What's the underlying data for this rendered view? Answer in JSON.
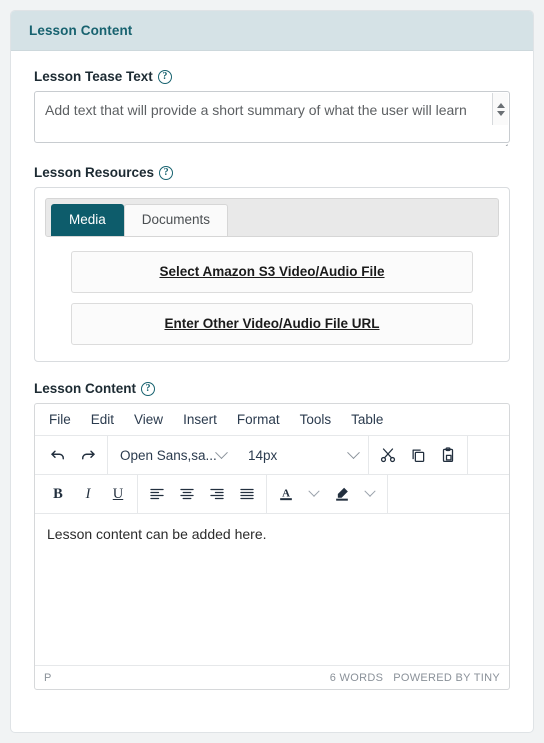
{
  "card": {
    "header_title": "Lesson Content"
  },
  "tease": {
    "label": "Lesson Tease Text",
    "help_icon": "question-circle-icon",
    "placeholder": "Add text that will provide a short summary of what the user will learn",
    "value": ""
  },
  "resources": {
    "label": "Lesson Resources",
    "help_icon": "question-circle-icon",
    "tabs": [
      {
        "label": "Media",
        "active": true
      },
      {
        "label": "Documents",
        "active": false
      }
    ],
    "buttons": [
      {
        "label": "Select Amazon S3 Video/Audio File"
      },
      {
        "label": "Enter Other Video/Audio File URL"
      }
    ],
    "accent_color": "#0d5c6b"
  },
  "editor": {
    "label": "Lesson Content",
    "help_icon": "question-circle-icon",
    "menubar": [
      "File",
      "Edit",
      "View",
      "Insert",
      "Format",
      "Tools",
      "Table"
    ],
    "toolbar_row1": {
      "undo_icon": "undo-icon",
      "redo_icon": "redo-icon",
      "font_family": "Open Sans,sa...",
      "font_size": "14px",
      "cut_icon": "scissors-icon",
      "copy_icon": "copy-icon",
      "paste_icon": "clipboard-icon"
    },
    "toolbar_row2": {
      "bold": "B",
      "italic": "I",
      "underline": "U",
      "align_left_icon": "align-left-icon",
      "align_center_icon": "align-center-icon",
      "align_right_icon": "align-right-icon",
      "align_justify_icon": "align-justify-icon",
      "text_color": "A",
      "text_color_icon": "text-color-icon",
      "highlight_icon": "highlight-pen-icon"
    },
    "content": "Lesson content can be added here.",
    "status": {
      "element_path": "P",
      "word_count": "6 WORDS",
      "branding": "POWERED BY TINY"
    }
  },
  "colors": {
    "header_bg": "#d5e2e6",
    "header_text": "#17626f",
    "teal": "#0d5c6b",
    "page_bg": "#f1f3f4"
  }
}
